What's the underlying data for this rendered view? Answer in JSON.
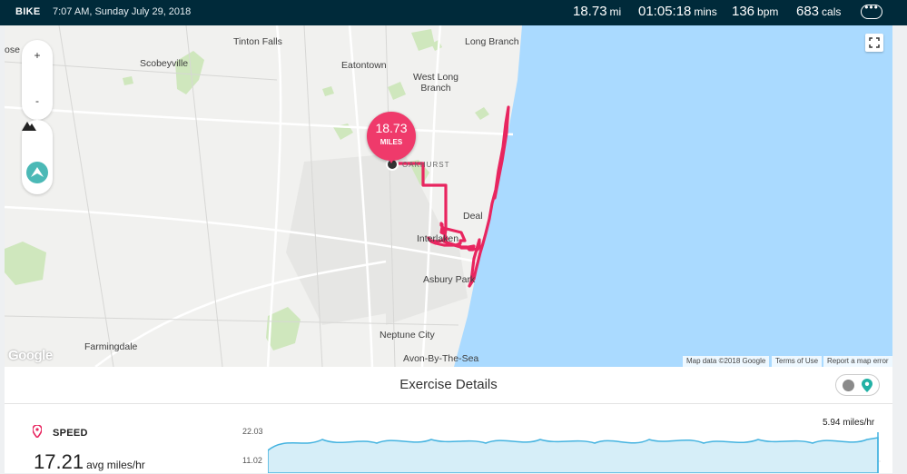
{
  "header": {
    "activity": "BIKE",
    "datetime": "7:07 AM, Sunday July 29, 2018",
    "distance": {
      "value": "18.73",
      "unit": "mi"
    },
    "duration": {
      "value": "01:05:18",
      "unit": "mins"
    },
    "heart_rate": {
      "value": "136",
      "unit": "bpm"
    },
    "calories": {
      "value": "683",
      "unit": "cals"
    },
    "more_icon": "ellipsis-icon"
  },
  "map": {
    "places": {
      "tinton_falls": "Tinton Falls",
      "long_branch": "Long Branch",
      "scobeyville": "Scobeyville",
      "eatontown": "Eatontown",
      "west_long_branch": "West Long\nBranch",
      "oakhurst": "OAKHURST",
      "deal": "Deal",
      "interlaken": "Interlaken",
      "asbury_park": "Asbury Park",
      "farmingdale": "Farmingdale",
      "neptune_city": "Neptune City",
      "avon_by_the_sea": "Avon-By-The-Sea",
      "ose": "ose"
    },
    "zoom_in": "+",
    "zoom_out": "-",
    "google_logo": "Google",
    "map_data": "Map data ©2018 Google",
    "terms": "Terms of Use",
    "report": "Report a map error",
    "marker": {
      "value": "18.73",
      "label": "MILES"
    },
    "colors": {
      "route": "#e8255f",
      "water": "#aadaff",
      "marker": "#ef3a6b"
    }
  },
  "details": {
    "title": "Exercise Details",
    "speed_label": "SPEED",
    "avg_value": "17.21",
    "avg_unit": "avg miles/hr",
    "y_max": "22.03",
    "y_mid": "11.02",
    "peak_label": "5.94 miles/hr"
  }
}
